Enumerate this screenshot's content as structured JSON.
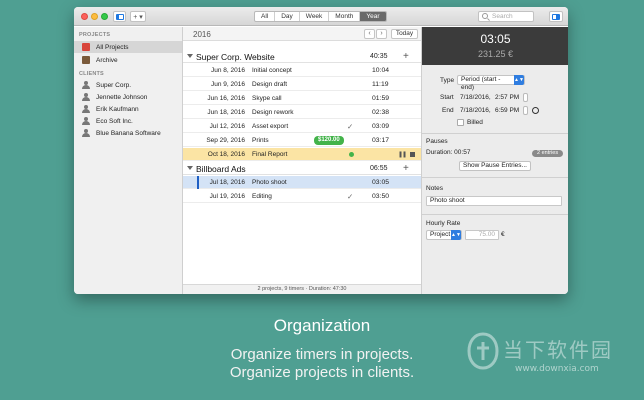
{
  "toolbar": {
    "add_label": "+ ▾",
    "tabs": [
      {
        "label": "All",
        "active": false
      },
      {
        "label": "Day",
        "active": false
      },
      {
        "label": "Week",
        "active": false
      },
      {
        "label": "Month",
        "active": false
      },
      {
        "label": "Year",
        "active": true
      }
    ],
    "search_placeholder": "Search"
  },
  "sidebar": {
    "projects_heading": "PROJECTS",
    "projects": [
      {
        "label": "All Projects",
        "active": true,
        "icon": "folder-icon"
      },
      {
        "label": "Archive",
        "active": false,
        "icon": "archive-icon"
      }
    ],
    "clients_heading": "CLIENTS",
    "clients": [
      {
        "label": "Super Corp."
      },
      {
        "label": "Jennette Johnson"
      },
      {
        "label": "Erik Kaufmann"
      },
      {
        "label": "Eco Soft Inc."
      },
      {
        "label": "Blue Banana Software"
      }
    ]
  },
  "list": {
    "year": "2016",
    "prev_label": "‹",
    "next_label": "›",
    "today_label": "Today",
    "groups": [
      {
        "name": "Super Corp. Website",
        "total": "40:35",
        "entries": [
          {
            "date": "Jun 8, 2016",
            "title": "Initial concept",
            "duration": "10:04"
          },
          {
            "date": "Jun 9, 2016",
            "title": "Design draft",
            "duration": "11:19"
          },
          {
            "date": "Jun 16, 2016",
            "title": "Skype call",
            "duration": "01:59"
          },
          {
            "date": "Jun 18, 2016",
            "title": "Design rework",
            "duration": "02:38"
          },
          {
            "date": "Jul 12, 2016",
            "title": "Asset export",
            "duration": "03:09",
            "checked": true
          },
          {
            "date": "Sep 29, 2016",
            "title": "Prints",
            "duration": "03:17",
            "badge": "$120.00"
          },
          {
            "date": "Oct 18, 2016",
            "title": "Final Report",
            "duration": "",
            "running": true
          }
        ]
      },
      {
        "name": "Billboard Ads",
        "total": "06:55",
        "entries": [
          {
            "date": "Jul 18, 2016",
            "title": "Photo shoot",
            "duration": "03:05",
            "selected": true
          },
          {
            "date": "Jul 19, 2016",
            "title": "Editing",
            "duration": "03:50",
            "checked": true
          }
        ]
      }
    ],
    "status": "2 projects, 9 timers  ·  Duration: 47:30"
  },
  "inspector": {
    "time": "03:05",
    "money": "231.25 €",
    "type_label": "Type",
    "type_value": "Period (start - end)",
    "start_label": "Start",
    "start_date": "7/18/2016,",
    "start_time": "2:57 PM",
    "end_label": "End",
    "end_date": "7/18/2016,",
    "end_time": "6:59 PM",
    "billed_label": "Billed",
    "pauses_title": "Pauses",
    "pauses_duration": "Duration: 00:57",
    "pauses_count": "2 entries",
    "show_pauses_label": "Show Pause Entries...",
    "notes_title": "Notes",
    "notes_value": "Photo shoot",
    "rate_title": "Hourly Rate",
    "rate_source": "Project",
    "rate_value": "75.00",
    "rate_currency": "€"
  },
  "caption": {
    "title": "Organization",
    "line1": "Organize timers in projects.",
    "line2": "Organize projects in clients."
  },
  "watermark": {
    "text": "当下软件园",
    "url": "www.downxia.com"
  }
}
